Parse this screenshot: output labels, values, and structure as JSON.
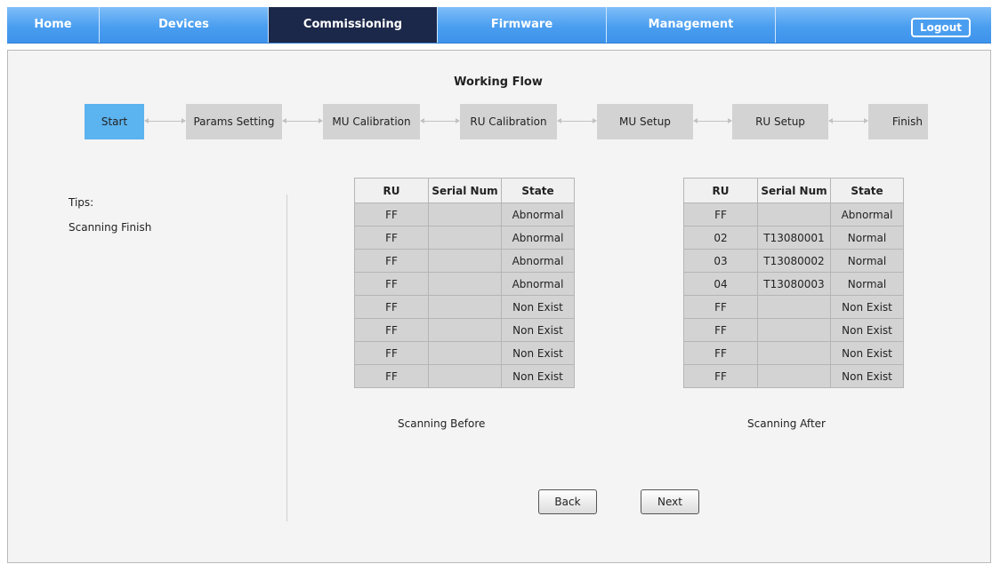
{
  "nav": {
    "tabs": [
      {
        "label": "Home"
      },
      {
        "label": "Devices"
      },
      {
        "label": "Commissioning"
      },
      {
        "label": "Firmware"
      },
      {
        "label": "Management"
      }
    ],
    "logout_label": "Logout",
    "active_tab": "Commissioning"
  },
  "workflow": {
    "title": "Working Flow",
    "steps": [
      "Start",
      "Params Setting",
      "MU Calibration",
      "RU Calibration",
      "MU Setup",
      "RU Setup",
      "Finish"
    ],
    "active_step": "Start"
  },
  "tips": {
    "label": "Tips:",
    "message": "Scanning Finish"
  },
  "tables": {
    "headers": [
      "RU",
      "Serial Num",
      "State"
    ],
    "before": {
      "caption": "Scanning Before",
      "rows": [
        [
          "FF",
          "",
          "Abnormal"
        ],
        [
          "FF",
          "",
          "Abnormal"
        ],
        [
          "FF",
          "",
          "Abnormal"
        ],
        [
          "FF",
          "",
          "Abnormal"
        ],
        [
          "FF",
          "",
          "Non Exist"
        ],
        [
          "FF",
          "",
          "Non Exist"
        ],
        [
          "FF",
          "",
          "Non Exist"
        ],
        [
          "FF",
          "",
          "Non Exist"
        ]
      ]
    },
    "after": {
      "caption": "Scanning After",
      "rows": [
        [
          "FF",
          "",
          "Abnormal"
        ],
        [
          "02",
          "T13080001",
          "Normal"
        ],
        [
          "03",
          "T13080002",
          "Normal"
        ],
        [
          "04",
          "T13080003",
          "Normal"
        ],
        [
          "FF",
          "",
          "Non Exist"
        ],
        [
          "FF",
          "",
          "Non Exist"
        ],
        [
          "FF",
          "",
          "Non Exist"
        ],
        [
          "FF",
          "",
          "Non Exist"
        ]
      ]
    }
  },
  "buttons": {
    "back": "Back",
    "next": "Next"
  },
  "colors": {
    "nav_blue": "#4a9ef0",
    "nav_active": "#1c2849",
    "step_active": "#5bb3ef",
    "step_idle": "#d3d3d3"
  }
}
